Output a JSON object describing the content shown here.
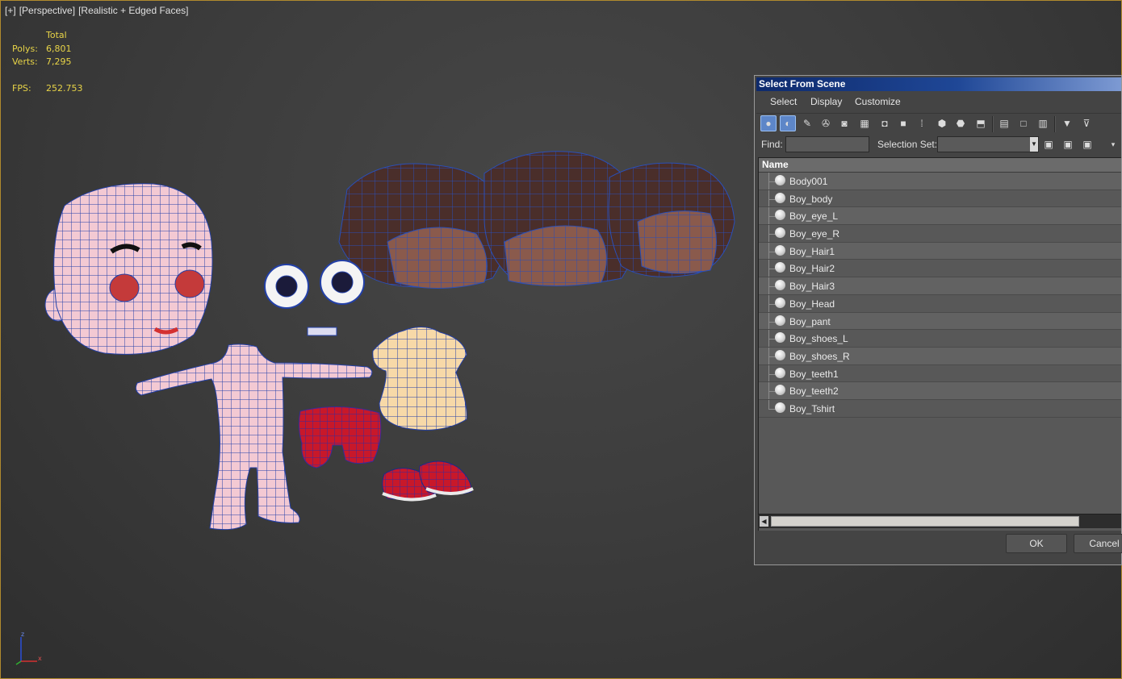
{
  "viewport": {
    "label": {
      "plus": "[+]",
      "view": "[Perspective]",
      "shading": "[Realistic + Edged Faces]"
    },
    "stats": {
      "total_label": "Total",
      "polys_label": "Polys:",
      "polys_value": "6,801",
      "verts_label": "Verts:",
      "verts_value": "7,295",
      "fps_label": "FPS:",
      "fps_value": "252.753"
    },
    "axis_labels": {
      "z": "z",
      "x": "x"
    }
  },
  "dialog": {
    "title": "Select From Scene",
    "menu": [
      "Select",
      "Display",
      "Customize"
    ],
    "find_label": "Find:",
    "find_value": "",
    "selection_set_label": "Selection Set:",
    "selection_set_value": "",
    "list_header": "Name",
    "objects": [
      "Body001",
      "Boy_body",
      "Boy_eye_L",
      "Boy_eye_R",
      "Boy_Hair1",
      "Boy_Hair2",
      "Boy_Hair3",
      "Boy_Head",
      "Boy_pant",
      "Boy_shoes_L",
      "Boy_shoes_R",
      "Boy_teeth1",
      "Boy_teeth2",
      "Boy_Tshirt"
    ],
    "ok_label": "OK",
    "cancel_label": "Cancel"
  },
  "colors": {
    "stats_text": "#e8d447",
    "viewport_border": "#b08a2e",
    "titlebar": "#1f4796",
    "wire": "#1c3c9c"
  }
}
